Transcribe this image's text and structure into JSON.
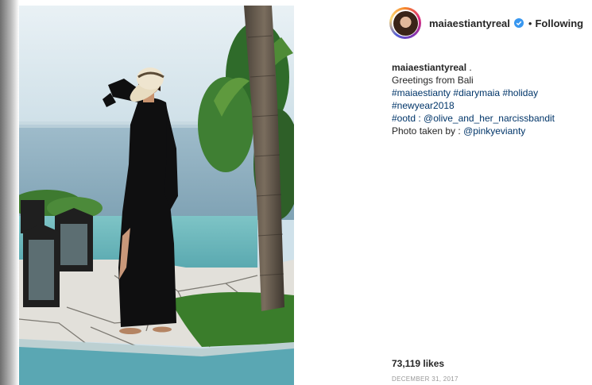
{
  "post": {
    "username": "maiaestiantyreal",
    "follow_separator": "•",
    "follow_status": "Following",
    "verified_icon": "verified-badge-icon",
    "caption": {
      "username": "maiaestiantyreal",
      "username_suffix": " .",
      "line1": "Greetings from Bali",
      "line2_tags": [
        "#maiaestianty",
        "#diarymaia",
        "#holiday"
      ],
      "line3_tag": "#newyear2018",
      "line4_tag": "#ootd",
      "line4_mid": " : ",
      "line4_mention": "@olive_and_her_narcissbandit",
      "line5_prefix": "Photo taken by : ",
      "line5_mention": "@pinkyevianty"
    },
    "likes": "73,119 likes",
    "date": "DECEMBER 31, 2017"
  },
  "colors": {
    "link": "#003569",
    "text": "#262626",
    "muted": "#999999",
    "verified": "#3897f0"
  }
}
